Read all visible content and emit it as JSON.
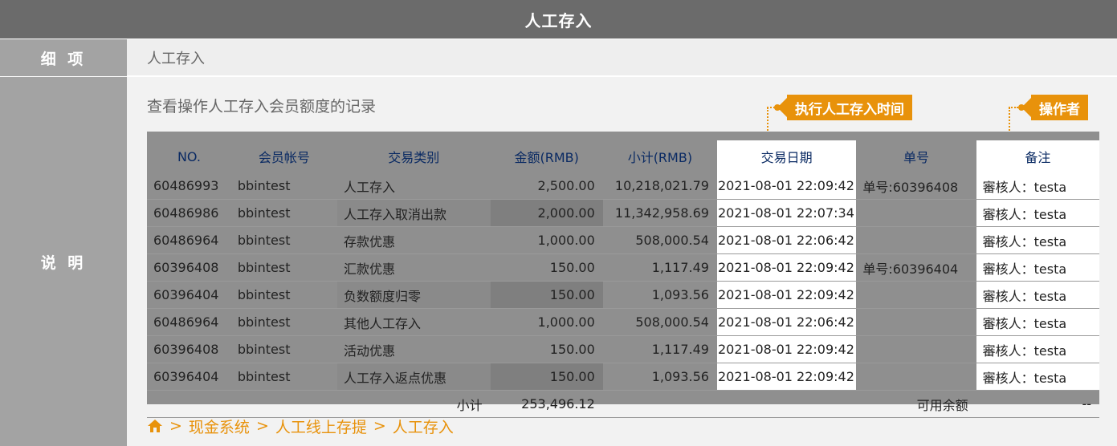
{
  "title": "人工存入",
  "rows": {
    "detail_label": "细 项",
    "detail_value": "人工存入",
    "desc_label": "说 明",
    "desc_text": "查看操作人工存入会员额度的记录"
  },
  "callouts": {
    "date_callout": "执行人工存入时间",
    "operator_callout": "操作者"
  },
  "table": {
    "headers": [
      "NO.",
      "会员帐号",
      "交易类别",
      "金额(RMB)",
      "小计(RMB)",
      "交易日期",
      "单号",
      "备注"
    ],
    "rows": [
      [
        "60486993",
        "bbintest",
        "人工存入",
        "2,500.00",
        "10,218,021.79",
        "2021-08-01 22:09:42",
        "单号:60396408",
        "審核人：testa"
      ],
      [
        "60486986",
        "bbintest",
        "人工存入取消出款",
        "2,000.00",
        "11,342,958.69",
        "2021-08-01 22:07:34",
        "",
        "審核人：testa"
      ],
      [
        "60486964",
        "bbintest",
        "存款优惠",
        "1,000.00",
        "508,000.54",
        "2021-08-01 22:06:42",
        "",
        "審核人：testa"
      ],
      [
        "60396408",
        "bbintest",
        "汇款优惠",
        "150.00",
        "1,117.49",
        "2021-08-01 22:09:42",
        "单号:60396404",
        "審核人：testa"
      ],
      [
        "60396404",
        "bbintest",
        "负数额度归零",
        "150.00",
        "1,093.56",
        "2021-08-01 22:09:42",
        "",
        "審核人：testa"
      ],
      [
        "60486964",
        "bbintest",
        "其他人工存入",
        "1,000.00",
        "508,000.54",
        "2021-08-01 22:06:42",
        "",
        "審核人：testa"
      ],
      [
        "60396408",
        "bbintest",
        "活动优惠",
        "150.00",
        "1,117.49",
        "2021-08-01 22:09:42",
        "",
        "審核人：testa"
      ],
      [
        "60396404",
        "bbintest",
        "人工存入返点优惠",
        "150.00",
        "1,093.56",
        "2021-08-01 22:09:42",
        "",
        "審核人：testa"
      ]
    ],
    "subtotal_label": "小计",
    "subtotal_value": "253,496.12",
    "available_label": "可用余额",
    "available_value": "--"
  },
  "breadcrumb": {
    "sep": ">",
    "items": [
      "现金系统",
      "人工线上存提",
      "人工存入"
    ]
  },
  "colors": {
    "accent": "#e8920b",
    "header_text": "#0a2a63"
  }
}
